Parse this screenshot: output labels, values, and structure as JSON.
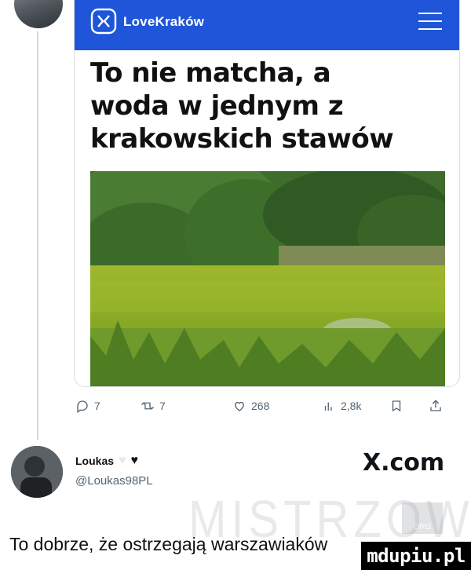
{
  "article": {
    "brand": "LoveKraków",
    "headline_lines": [
      "To nie matcha, a",
      "woda w jednym z",
      "krakowskich stawów"
    ],
    "photo_alt": "photo"
  },
  "actions": {
    "replies": "7",
    "retweets": "7",
    "likes": "268",
    "views": "2,8k"
  },
  "author": {
    "name": "Loukas",
    "handle": "@Loukas98PL"
  },
  "site": "X.com",
  "watermark": "MISTRZOWIE",
  "watermark_badge": "ORG",
  "caption": "To dobrze, że ostrzegają warszawiaków",
  "footer_badge": "mdupiu.pl",
  "colors": {
    "brand_blue": "#1f55d8",
    "icon_gray": "#536471"
  }
}
